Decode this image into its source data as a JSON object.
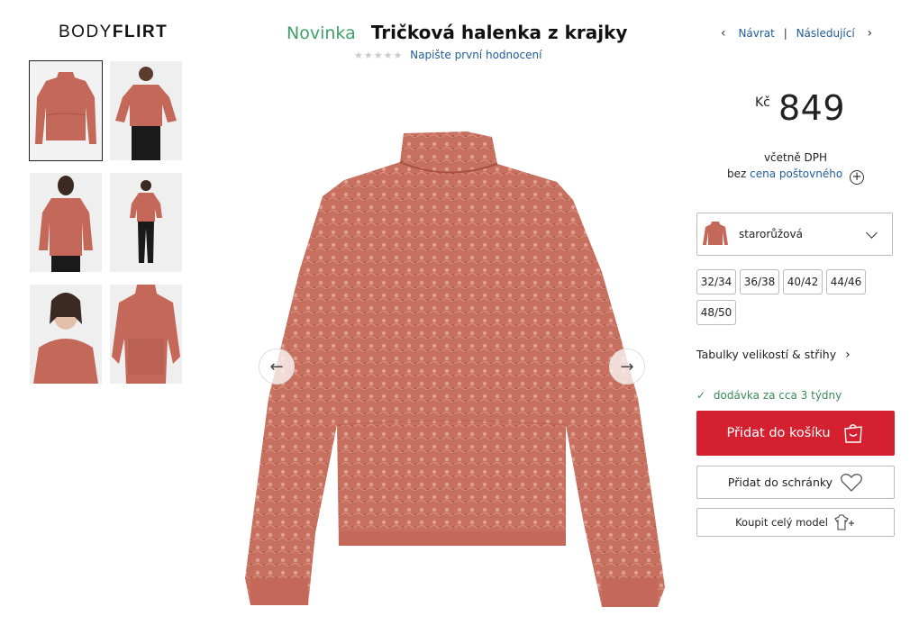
{
  "brand": {
    "part1": "BODY",
    "part2": "FLIRT"
  },
  "header": {
    "badge": "Novinka",
    "title": "Tričková halenka z krajky",
    "stars": "★★★★★",
    "rate_link": "Napište první hodnocení",
    "back_label": "Návrat",
    "separator": "|",
    "next_label": "Následující",
    "prev_icon": "‹",
    "next_icon": "›"
  },
  "thumbnails": [
    {
      "alt": "blouse-front"
    },
    {
      "alt": "model-front"
    },
    {
      "alt": "model-back"
    },
    {
      "alt": "model-full"
    },
    {
      "alt": "model-closeup"
    },
    {
      "alt": "blouse-detail"
    }
  ],
  "price": {
    "currency": "Kč",
    "amount": "849",
    "vat": "včetně DPH",
    "ship_prefix": "bez",
    "ship_link": "cena poštovného"
  },
  "color": {
    "label": "starorůžová",
    "accent": "#c4685a"
  },
  "sizes": [
    "32/34",
    "36/38",
    "40/42",
    "44/46",
    "48/50"
  ],
  "size_guide": "Tabulky velikostí & střihy",
  "delivery": {
    "check": "✓",
    "text": "dodávka za cca 3 týdny"
  },
  "actions": {
    "cart": "Přidat do košíku",
    "wishlist": "Přidat do schránky",
    "full_model": "Koupit celý model"
  },
  "colors": {
    "brand_red": "#d4202f",
    "link_blue": "#1f5c99",
    "green": "#3fa06a",
    "product": "#c4685a"
  }
}
